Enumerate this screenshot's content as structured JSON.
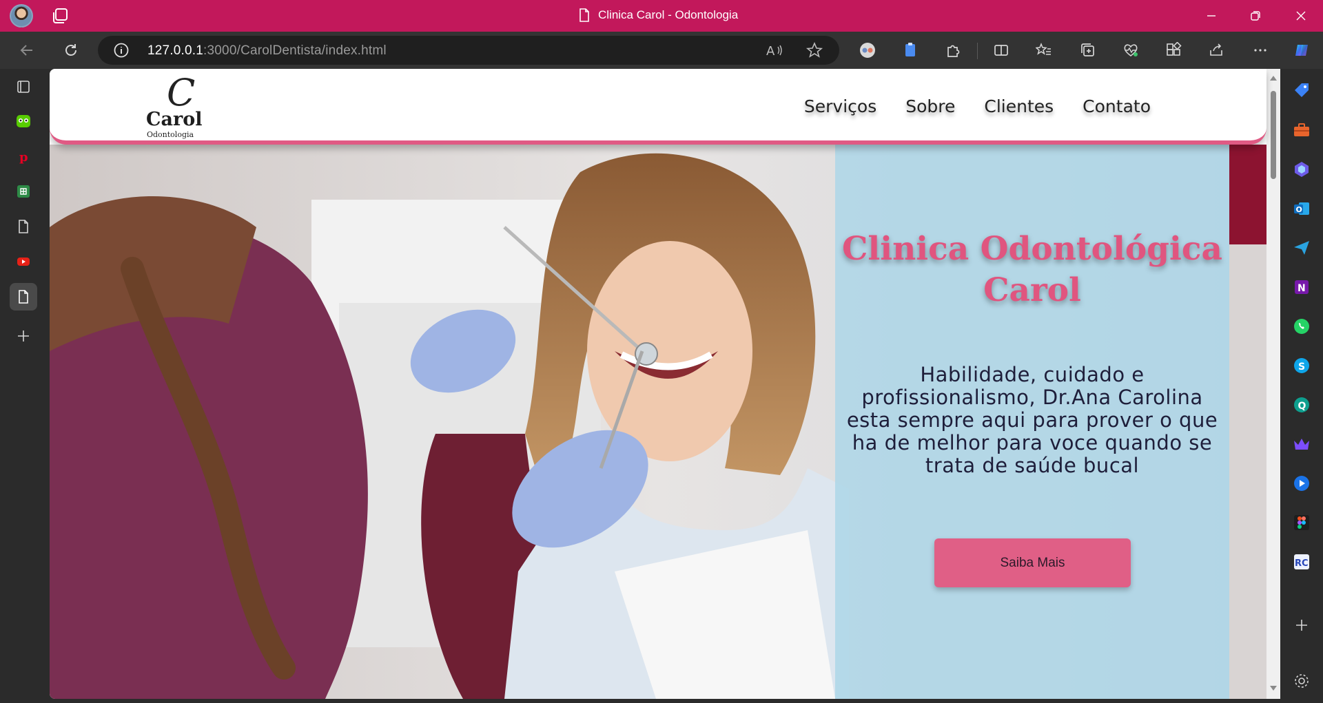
{
  "window": {
    "title": "Clinica Carol - Odontologia",
    "accent": "#c2185b"
  },
  "addressbar": {
    "url_host": "127.0.0.1",
    "url_rest": ":3000/CarolDentista/index.html"
  },
  "site": {
    "logo": {
      "mark": "C",
      "name": "Carol",
      "sub": "Odontologia"
    },
    "nav": [
      "Serviços",
      "Sobre",
      "Clientes",
      "Contato"
    ],
    "hero": {
      "title": "Clinica Odontológica Carol",
      "text": "Habilidade, cuidado e profissionalismo, Dr.Ana Carolina esta sempre aqui para prover o que ha de melhor para voce quando se trata de saúde bucal",
      "button": "Saiba Mais"
    },
    "colors": {
      "brand_pink": "#e0557f",
      "panel": "#abd6e8"
    }
  },
  "icons": {
    "left_sidebar": [
      "workspaces-icon",
      "duolingo-icon",
      "pinterest-icon",
      "spreadsheet-icon",
      "page-icon",
      "youtube-icon",
      "page-icon",
      "add-icon"
    ],
    "right_sidebar": [
      "tag-icon",
      "toolbox-icon",
      "copilot-icon",
      "outlook-icon",
      "send-icon",
      "onenote-icon",
      "whatsapp-icon",
      "skype-icon",
      "search-q-icon",
      "crown-icon",
      "play-icon",
      "figma-icon",
      "rc-icon",
      "add-icon",
      "settings-icon"
    ]
  }
}
